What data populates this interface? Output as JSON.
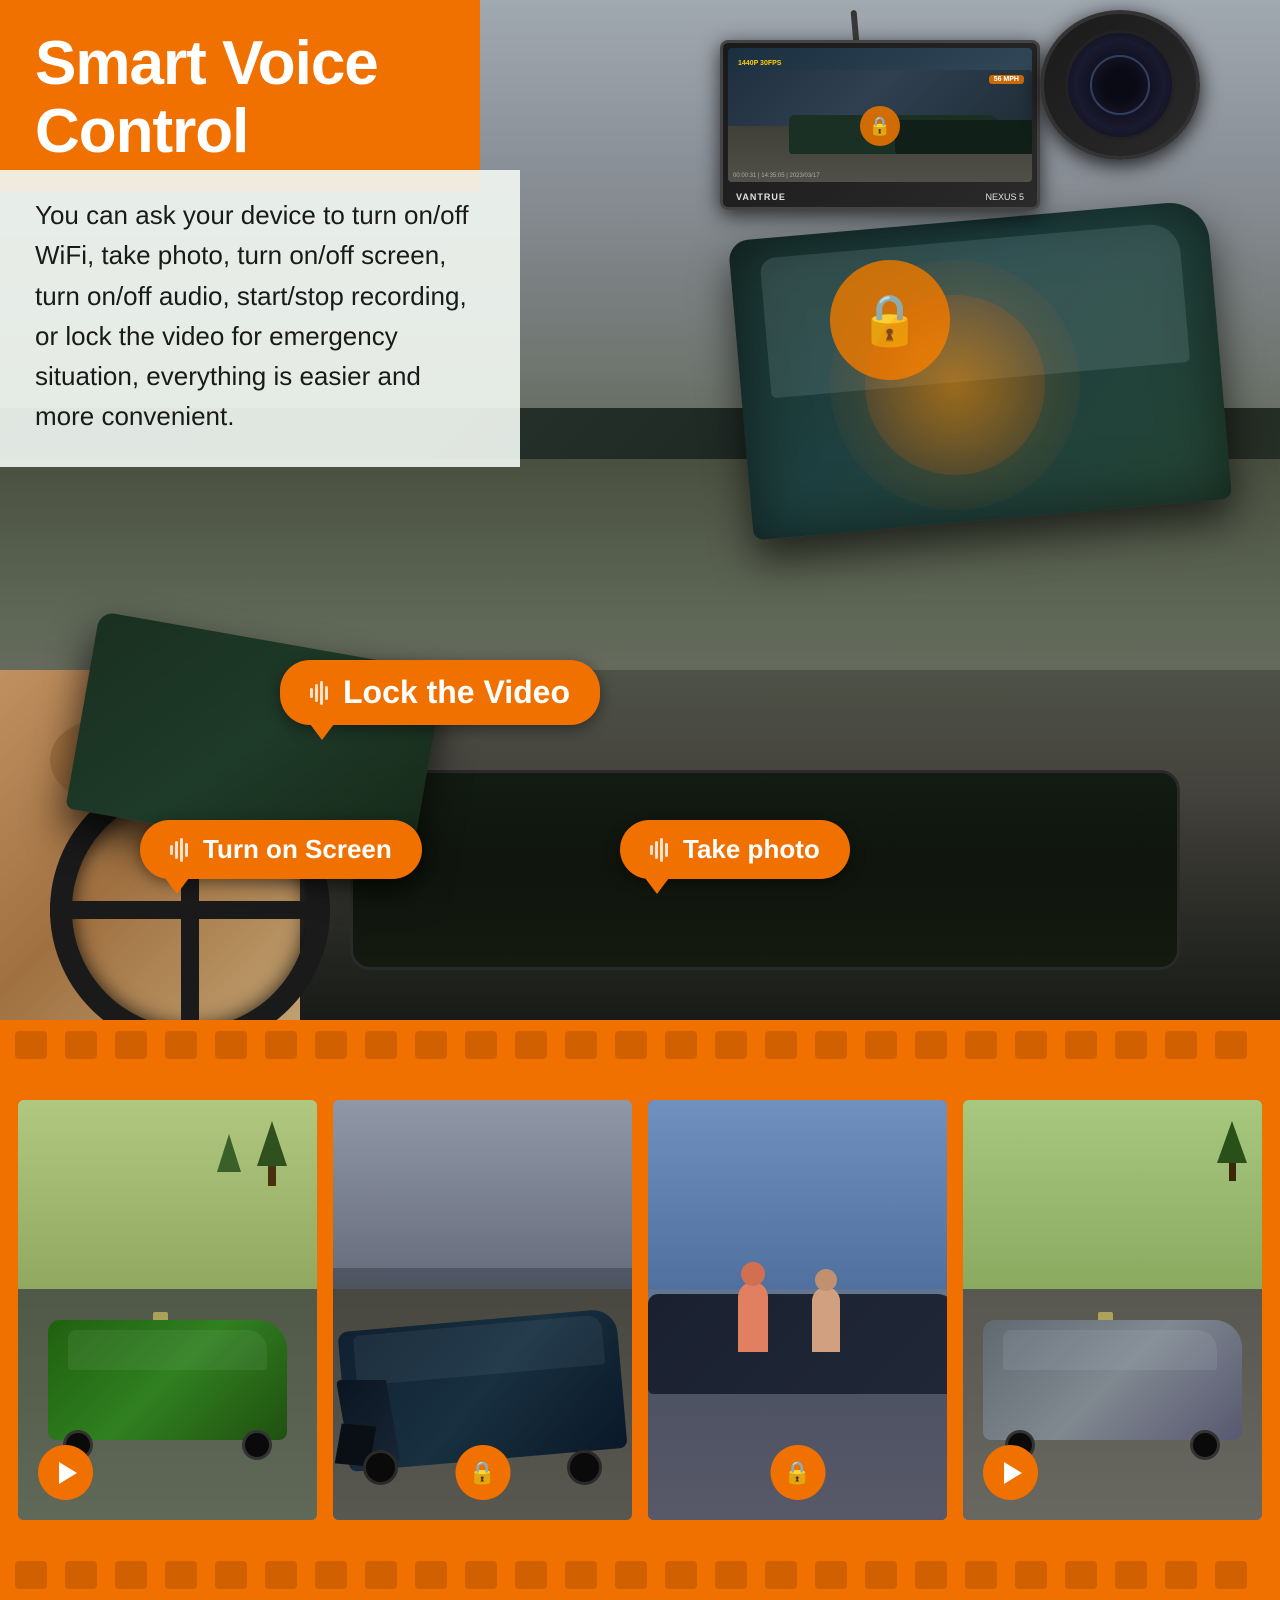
{
  "page": {
    "title": "Smart Voice Control",
    "subtitle": "Smart Voice Control",
    "description": "You can ask your device to turn on/off WiFi, take photo, turn on/off screen, turn on/off audio, start/stop recording, or lock the video for emergency situation, everything is easier and more convenient."
  },
  "voice_commands": {
    "lock_video": "Lock the Video",
    "turn_on_screen": "Turn on Screen",
    "take_photo": "Take photo"
  },
  "dashcam": {
    "brand": "VANTRUE",
    "model": "NEXUS 5",
    "resolution": "1440P 30FPS",
    "speed": "56 MPH"
  },
  "filmstrip": {
    "frames": [
      {
        "type": "play",
        "desc": "Green car on road"
      },
      {
        "type": "lock",
        "desc": "Dark car accident scene"
      },
      {
        "type": "lock",
        "desc": "People at car scene"
      },
      {
        "type": "play",
        "desc": "Gray car on road"
      }
    ]
  },
  "colors": {
    "orange": "#f07000",
    "orange_dark": "#d06000",
    "white": "#ffffff",
    "dark": "#1a1a1a"
  }
}
